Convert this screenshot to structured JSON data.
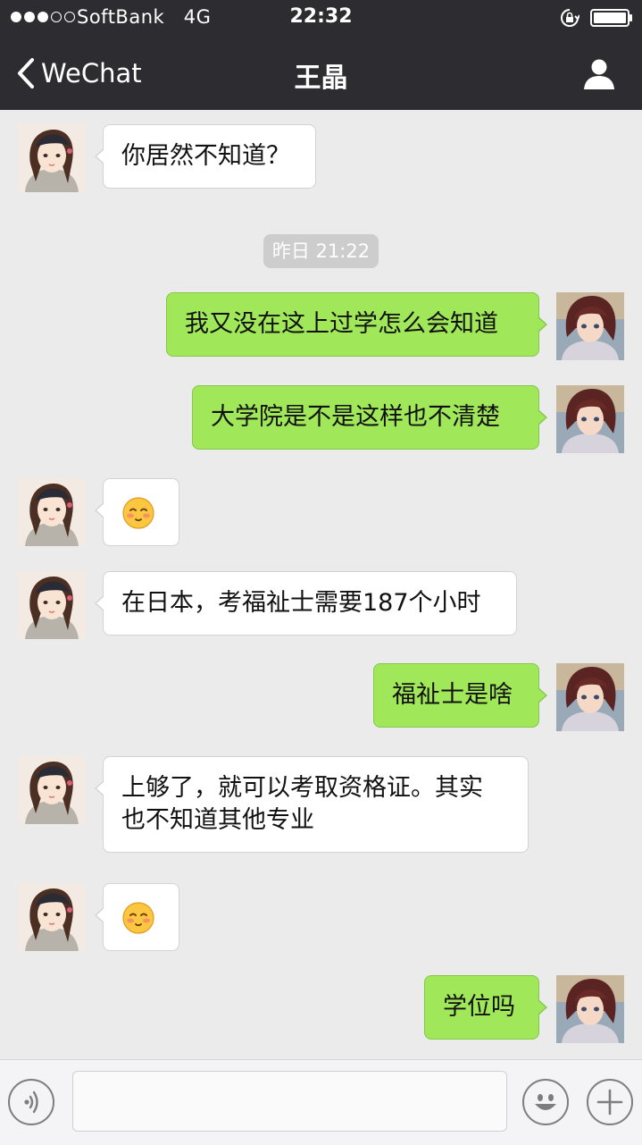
{
  "status_bar": {
    "carrier": "SoftBank",
    "network": "4G",
    "time": "22:32",
    "signal_filled": 3,
    "signal_total": 5,
    "icons": [
      "signal-dots-icon",
      "rotation-lock-icon",
      "battery-icon"
    ]
  },
  "nav": {
    "back_label": "WeChat",
    "title": "王晶",
    "icons": [
      "chevron-left-icon",
      "profile-icon"
    ]
  },
  "chat": {
    "timestamp": "昨日 21:22",
    "messages": [
      {
        "side": "left",
        "type": "text",
        "lines": [
          "你居然不知道？"
        ]
      },
      {
        "side": "right",
        "type": "text",
        "lines": [
          "我又没在这上过学怎么会知道"
        ]
      },
      {
        "side": "right",
        "type": "text",
        "lines": [
          "大学院是不是这样也不清楚"
        ]
      },
      {
        "side": "left",
        "type": "emoji",
        "icon": "blushing-face-icon"
      },
      {
        "side": "left",
        "type": "text",
        "lines": [
          "在日本，考福祉士需要187个小时"
        ]
      },
      {
        "side": "right",
        "type": "text",
        "lines": [
          "福祉士是啥"
        ]
      },
      {
        "side": "left",
        "type": "text",
        "lines": [
          "上够了，就可以考取资格证。其实",
          "也不知道其他专业"
        ]
      },
      {
        "side": "left",
        "type": "emoji",
        "icon": "blushing-face-icon"
      },
      {
        "side": "right",
        "type": "text",
        "lines": [
          "学位吗"
        ]
      }
    ]
  },
  "input_bar": {
    "text_value": "",
    "icons": [
      "voice-icon",
      "emoji-icon",
      "plus-icon"
    ]
  },
  "colors": {
    "header_bg": "#2d2d31",
    "chat_bg": "#ebebeb",
    "outgoing_bubble": "#a0e759",
    "incoming_bubble": "#ffffff",
    "timestamp_bg": "#cdcdcd"
  }
}
